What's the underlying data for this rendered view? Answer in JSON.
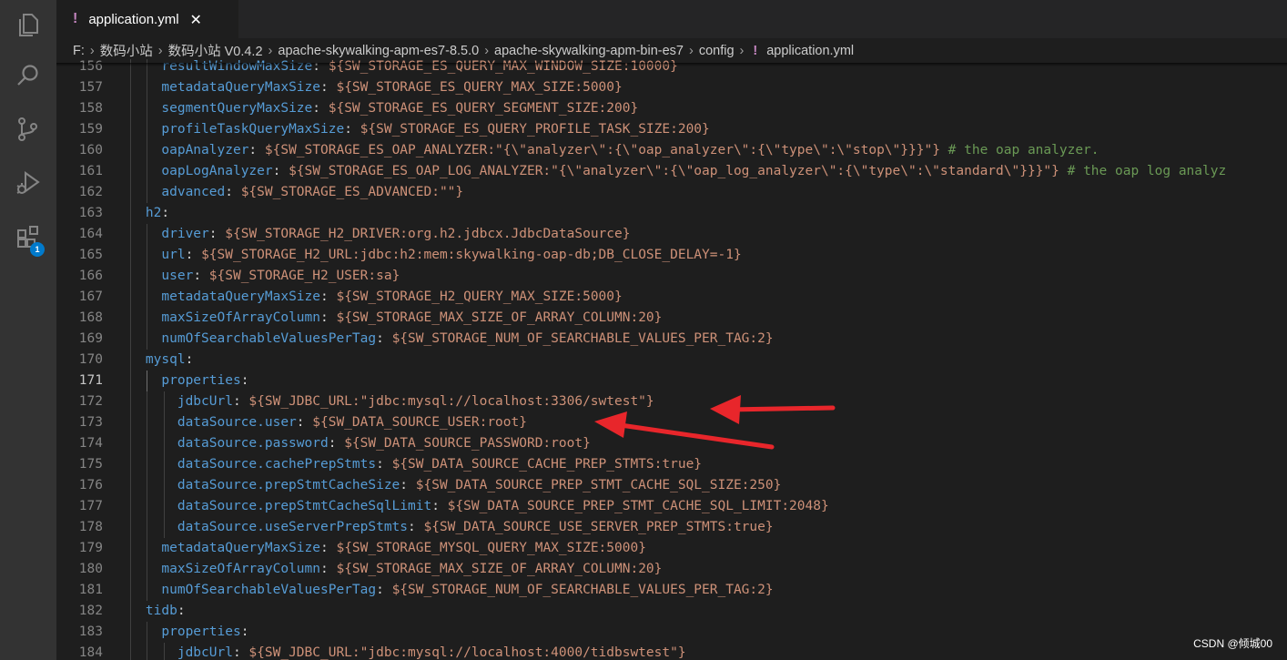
{
  "activity_bar": {
    "icons": [
      "files-icon",
      "search-icon",
      "source-control-icon",
      "run-debug-icon",
      "extensions-icon"
    ],
    "extensions_badge": "1"
  },
  "tab": {
    "title": "application.yml",
    "modified_glyph": "!",
    "close_glyph": "✕"
  },
  "breadcrumb": {
    "items": [
      "F:",
      "数码小站",
      "数码小站 V0.4.2",
      "apache-skywalking-apm-es7-8.5.0",
      "apache-skywalking-apm-bin-es7",
      "config",
      "application.yml"
    ],
    "file_glyph": "!"
  },
  "editor": {
    "active_line": "171",
    "lines": [
      {
        "num": "156",
        "indent": "      ",
        "key": "resultWindowMaxSize",
        "value": "${SW_STORAGE_ES_QUERY_MAX_WINDOW_SIZE:10000}",
        "comment": ""
      },
      {
        "num": "157",
        "indent": "      ",
        "key": "metadataQueryMaxSize",
        "value": "${SW_STORAGE_ES_QUERY_MAX_SIZE:5000}",
        "comment": ""
      },
      {
        "num": "158",
        "indent": "      ",
        "key": "segmentQueryMaxSize",
        "value": "${SW_STORAGE_ES_QUERY_SEGMENT_SIZE:200}",
        "comment": ""
      },
      {
        "num": "159",
        "indent": "      ",
        "key": "profileTaskQueryMaxSize",
        "value": "${SW_STORAGE_ES_QUERY_PROFILE_TASK_SIZE:200}",
        "comment": ""
      },
      {
        "num": "160",
        "indent": "      ",
        "key": "oapAnalyzer",
        "value": "${SW_STORAGE_ES_OAP_ANALYZER:\"{\\\"analyzer\\\":{\\\"oap_analyzer\\\":{\\\"type\\\":\\\"stop\\\"}}}\"}",
        "comment": " # the oap analyzer."
      },
      {
        "num": "161",
        "indent": "      ",
        "key": "oapLogAnalyzer",
        "value": "${SW_STORAGE_ES_OAP_LOG_ANALYZER:\"{\\\"analyzer\\\":{\\\"oap_log_analyzer\\\":{\\\"type\\\":\\\"standard\\\"}}}\"}",
        "comment": " # the oap log analyz"
      },
      {
        "num": "162",
        "indent": "      ",
        "key": "advanced",
        "value": "${SW_STORAGE_ES_ADVANCED:\"\"}",
        "comment": ""
      },
      {
        "num": "163",
        "indent": "    ",
        "key": "h2",
        "value": "",
        "comment": ""
      },
      {
        "num": "164",
        "indent": "      ",
        "key": "driver",
        "value": "${SW_STORAGE_H2_DRIVER:org.h2.jdbcx.JdbcDataSource}",
        "comment": ""
      },
      {
        "num": "165",
        "indent": "      ",
        "key": "url",
        "value": "${SW_STORAGE_H2_URL:jdbc:h2:mem:skywalking-oap-db;DB_CLOSE_DELAY=-1}",
        "comment": ""
      },
      {
        "num": "166",
        "indent": "      ",
        "key": "user",
        "value": "${SW_STORAGE_H2_USER:sa}",
        "comment": ""
      },
      {
        "num": "167",
        "indent": "      ",
        "key": "metadataQueryMaxSize",
        "value": "${SW_STORAGE_H2_QUERY_MAX_SIZE:5000}",
        "comment": ""
      },
      {
        "num": "168",
        "indent": "      ",
        "key": "maxSizeOfArrayColumn",
        "value": "${SW_STORAGE_MAX_SIZE_OF_ARRAY_COLUMN:20}",
        "comment": ""
      },
      {
        "num": "169",
        "indent": "      ",
        "key": "numOfSearchableValuesPerTag",
        "value": "${SW_STORAGE_NUM_OF_SEARCHABLE_VALUES_PER_TAG:2}",
        "comment": ""
      },
      {
        "num": "170",
        "indent": "    ",
        "key": "mysql",
        "value": "",
        "comment": ""
      },
      {
        "num": "171",
        "indent": "      ",
        "key": "properties",
        "value": "",
        "comment": ""
      },
      {
        "num": "172",
        "indent": "        ",
        "key": "jdbcUrl",
        "value": "${SW_JDBC_URL:\"jdbc:mysql://localhost:3306/swtest\"}",
        "comment": ""
      },
      {
        "num": "173",
        "indent": "        ",
        "key": "dataSource.user",
        "value": "${SW_DATA_SOURCE_USER:root}",
        "comment": ""
      },
      {
        "num": "174",
        "indent": "        ",
        "key": "dataSource.password",
        "value": "${SW_DATA_SOURCE_PASSWORD:root}",
        "comment": ""
      },
      {
        "num": "175",
        "indent": "        ",
        "key": "dataSource.cachePrepStmts",
        "value": "${SW_DATA_SOURCE_CACHE_PREP_STMTS:true}",
        "comment": ""
      },
      {
        "num": "176",
        "indent": "        ",
        "key": "dataSource.prepStmtCacheSize",
        "value": "${SW_DATA_SOURCE_PREP_STMT_CACHE_SQL_SIZE:250}",
        "comment": ""
      },
      {
        "num": "177",
        "indent": "        ",
        "key": "dataSource.prepStmtCacheSqlLimit",
        "value": "${SW_DATA_SOURCE_PREP_STMT_CACHE_SQL_LIMIT:2048}",
        "comment": ""
      },
      {
        "num": "178",
        "indent": "        ",
        "key": "dataSource.useServerPrepStmts",
        "value": "${SW_DATA_SOURCE_USE_SERVER_PREP_STMTS:true}",
        "comment": ""
      },
      {
        "num": "179",
        "indent": "      ",
        "key": "metadataQueryMaxSize",
        "value": "${SW_STORAGE_MYSQL_QUERY_MAX_SIZE:5000}",
        "comment": ""
      },
      {
        "num": "180",
        "indent": "      ",
        "key": "maxSizeOfArrayColumn",
        "value": "${SW_STORAGE_MAX_SIZE_OF_ARRAY_COLUMN:20}",
        "comment": ""
      },
      {
        "num": "181",
        "indent": "      ",
        "key": "numOfSearchableValuesPerTag",
        "value": "${SW_STORAGE_NUM_OF_SEARCHABLE_VALUES_PER_TAG:2}",
        "comment": ""
      },
      {
        "num": "182",
        "indent": "    ",
        "key": "tidb",
        "value": "",
        "comment": ""
      },
      {
        "num": "183",
        "indent": "      ",
        "key": "properties",
        "value": "",
        "comment": ""
      },
      {
        "num": "184",
        "indent": "        ",
        "key": "jdbcUrl",
        "value": "${SW_JDBC_URL:\"jdbc:mysql://localhost:4000/tidbswtest\"}",
        "comment": ""
      }
    ]
  },
  "annotation": {
    "arrow_color": "#e8262b"
  },
  "watermark": "CSDN @倾城00",
  "colors": {
    "key": "#569cd6",
    "value": "#ce9178",
    "comment": "#6a9955",
    "badge": "#007acc",
    "modified": "#c586c0"
  }
}
